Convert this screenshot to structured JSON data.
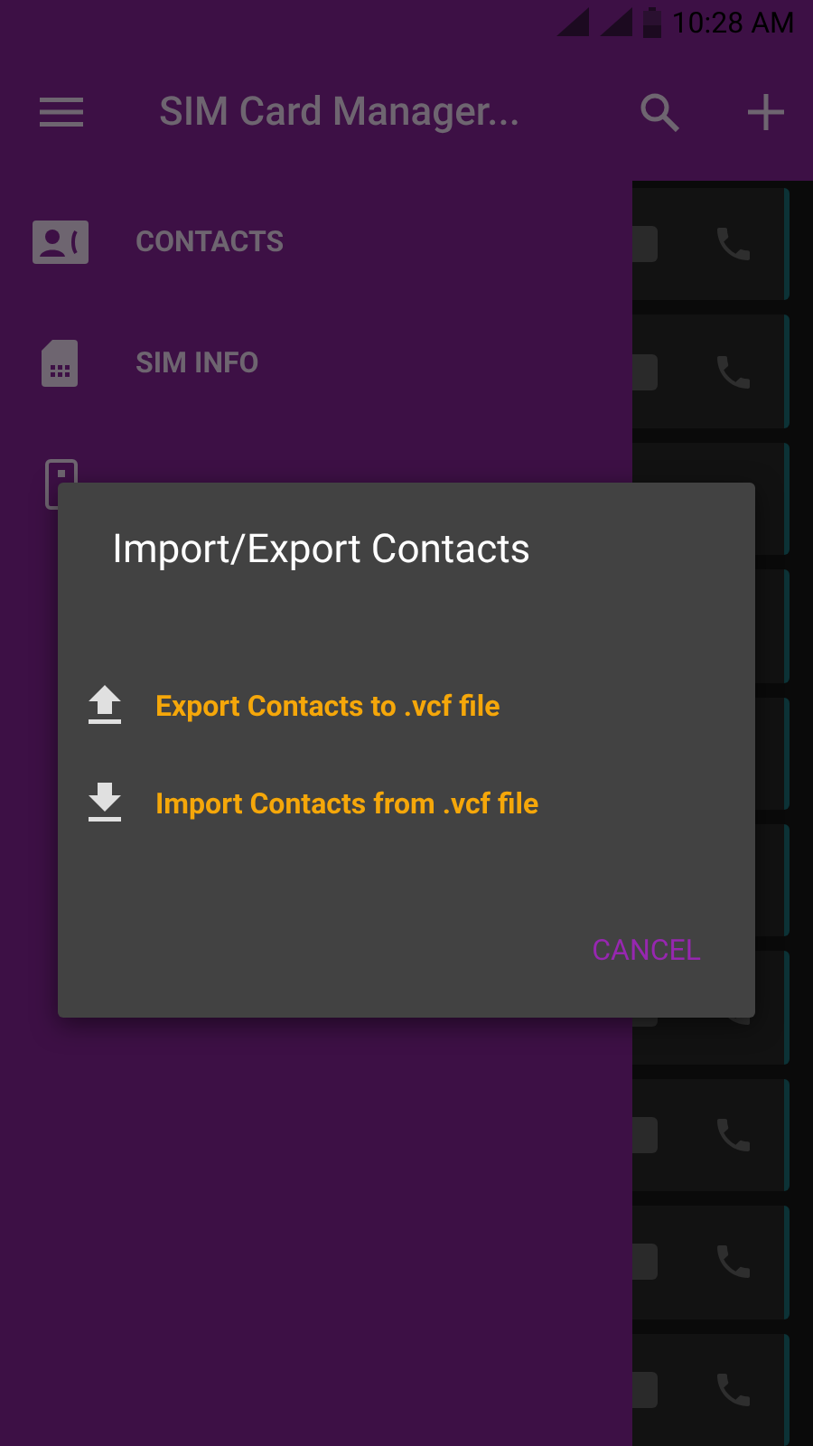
{
  "status_bar": {
    "time": "10:28 AM"
  },
  "app_bar": {
    "title": "SIM Card Manager..."
  },
  "drawer": {
    "items": [
      {
        "label": "CONTACTS",
        "kind": "contacts"
      },
      {
        "label": "SIM INFO",
        "kind": "sim"
      },
      {
        "kind": "device"
      }
    ]
  },
  "dialog": {
    "title": "Import/Export Contacts",
    "options": [
      {
        "label": "Export Contacts to .vcf file",
        "kind": "upload"
      },
      {
        "label": "Import Contacts from .vcf file",
        "kind": "download"
      }
    ],
    "cancel": "CANCEL"
  }
}
